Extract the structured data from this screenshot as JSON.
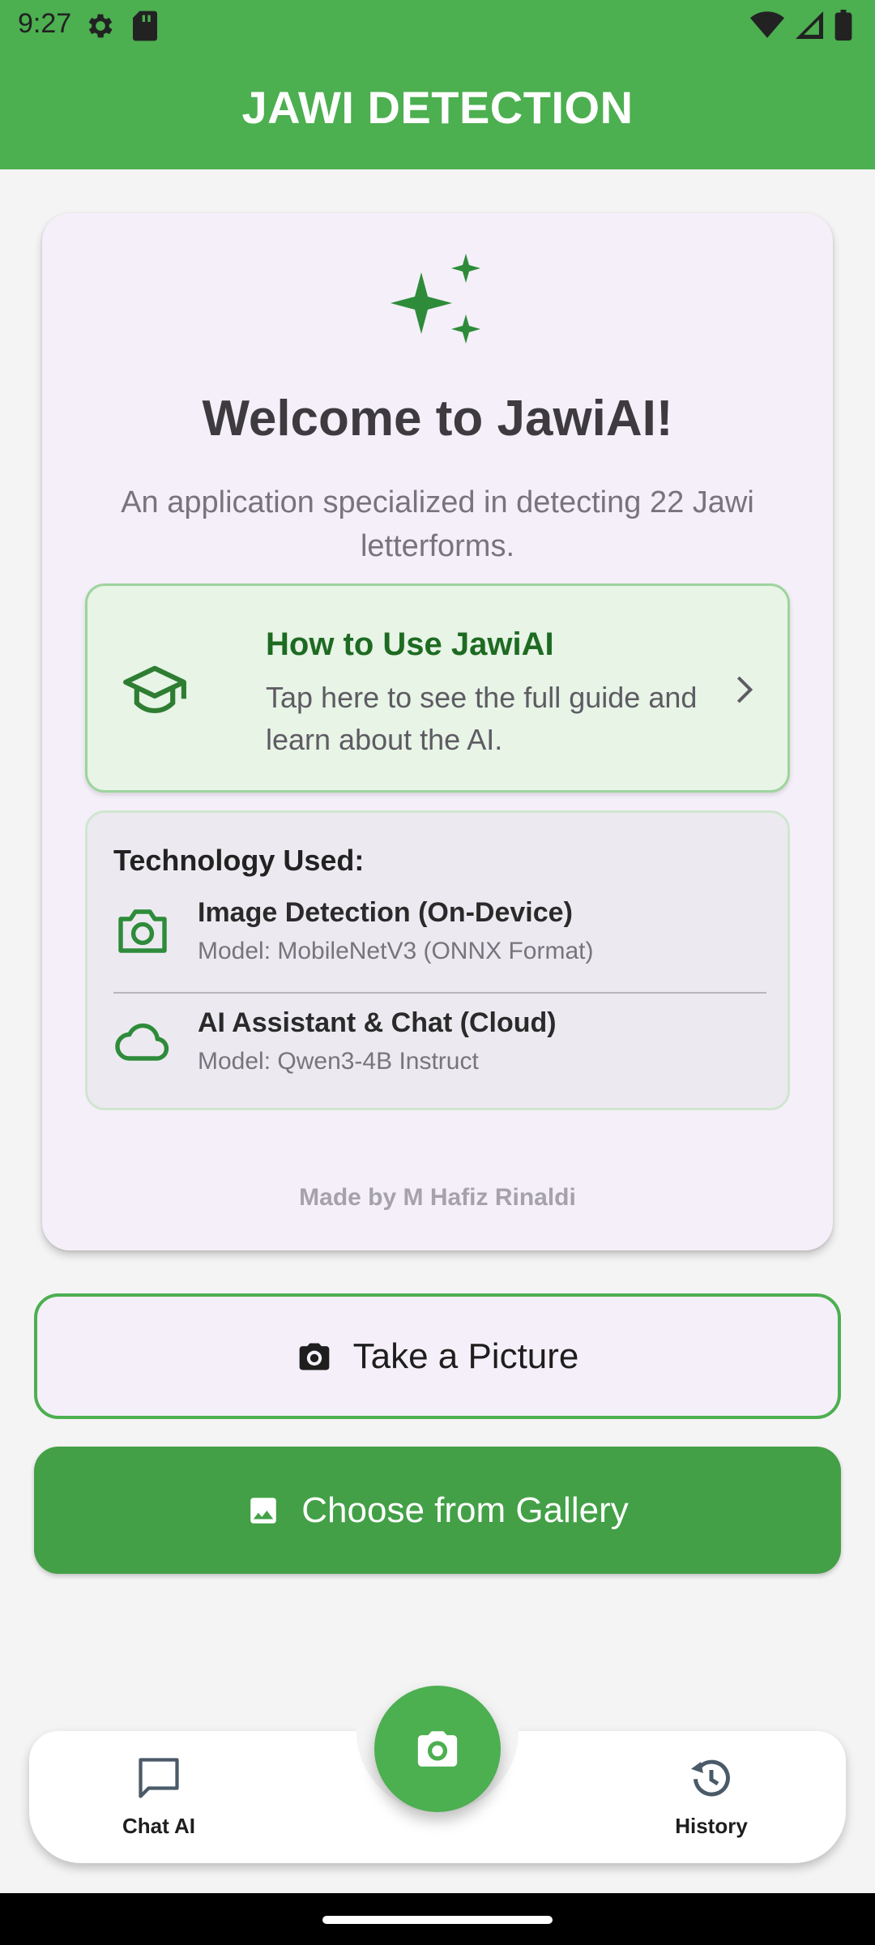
{
  "status_bar": {
    "time": "9:27",
    "left_icons": [
      "settings-icon",
      "sd-card-icon"
    ],
    "right_icons": [
      "wifi-icon",
      "signal-icon",
      "battery-icon"
    ]
  },
  "app_bar": {
    "title": "JAWI DETECTION"
  },
  "welcome": {
    "icon": "sparkle-icon",
    "title": "Welcome to JawiAI!",
    "subtitle": "An application specialized in detecting 22 Jawi letterforms."
  },
  "guide": {
    "icon": "graduation-cap-icon",
    "title": "How to Use JawiAI",
    "description": "Tap here to see the full guide and learn about the AI.",
    "chevron": "chevron-right-icon"
  },
  "technology": {
    "heading": "Technology Used:",
    "items": [
      {
        "icon": "camera-outline-icon",
        "title": "Image Detection (On-Device)",
        "model": "Model: MobileNetV3 (ONNX Format)"
      },
      {
        "icon": "cloud-icon",
        "title": "AI Assistant & Chat (Cloud)",
        "model": "Model: Qwen3-4B Instruct"
      }
    ]
  },
  "footer": {
    "made_by": "Made by M Hafiz Rinaldi"
  },
  "actions": {
    "take_picture": "Take a Picture",
    "choose_gallery": "Choose from Gallery"
  },
  "bottom_nav": {
    "chat": "Chat AI",
    "history": "History"
  },
  "colors": {
    "primary": "#4caf50",
    "primary_dark": "#1e6a22",
    "button_green": "#43a047",
    "card_bg": "#f4eff8",
    "guide_bg": "#e7f4e6"
  }
}
